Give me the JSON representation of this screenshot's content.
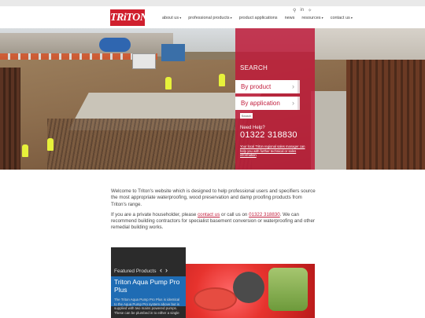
{
  "header": {
    "logo_text": "TRiTON",
    "icons": [
      "search-icon",
      "linkedin-icon",
      "twitter-icon"
    ],
    "icon_glyphs": [
      "⚲",
      "in",
      "✧"
    ],
    "nav": [
      {
        "label": "about us",
        "dropdown": true
      },
      {
        "label": "professional products",
        "dropdown": true
      },
      {
        "label": "product applications",
        "dropdown": false
      },
      {
        "label": "news",
        "dropdown": false
      },
      {
        "label": "resources",
        "dropdown": true
      },
      {
        "label": "contact us",
        "dropdown": true
      }
    ]
  },
  "search_panel": {
    "title": "SEARCH",
    "by_product": "By product",
    "by_application": "By application",
    "search_button": "Search",
    "need_help": "Need Help?",
    "phone": "01322 318830",
    "help_text": "Your local Triton regional sales manager can help you with further technical or sales information"
  },
  "intro": {
    "para1": "Welcome to Triton's website which is designed to help professional users and specifiers source the most appropriate waterproofing, wood preservation and damp proofing products from Triton's range.",
    "para2_before": "If you are a private householder, please ",
    "para2_link1": "contact us",
    "para2_mid": " or call us on ",
    "para2_link2": "01322 318830",
    "para2_after": ". We can recommend building contractors for specialist basement conversion or waterproofing and other remedial building works."
  },
  "featured": {
    "label": "Featured Products",
    "prev": "‹",
    "next": "›",
    "title": "Triton Aqua Pump Pro Plus",
    "description": "The Triton Aqua Pump Pro Plus is identical to the Aqua Pump Pro system above but is supplied with two mains powered pumps. These can be plumbed in to either a single"
  },
  "colors": {
    "brand_red": "#d0202e",
    "panel_red": "#be1c3a",
    "featured_blue": "#1f6cb4"
  }
}
